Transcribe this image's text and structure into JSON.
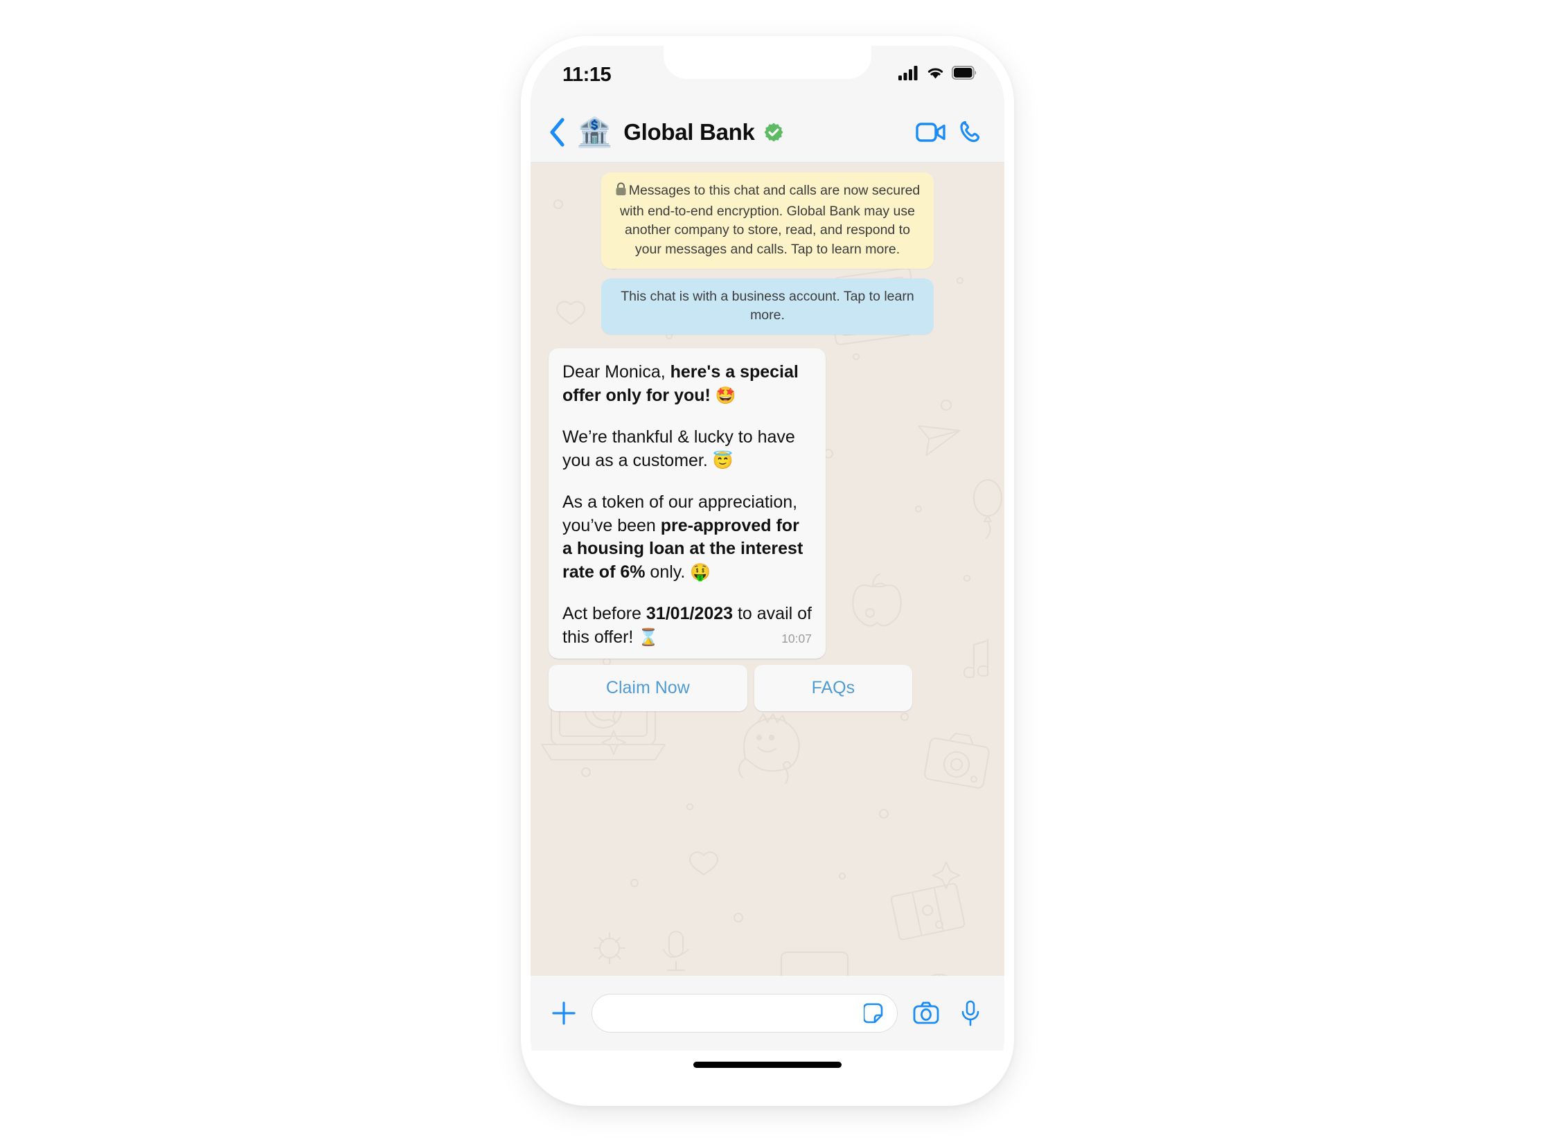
{
  "status_bar": {
    "time": "11:15",
    "signal_icon": "cellular-signal-icon",
    "wifi_icon": "wifi-icon",
    "battery_icon": "battery-icon"
  },
  "chat_header": {
    "back_icon": "back-chevron-icon",
    "avatar_emoji": "🏦",
    "contact_name": "Global Bank",
    "verified_icon": "verified-badge-icon",
    "video_call_icon": "video-call-icon",
    "voice_call_icon": "voice-call-icon"
  },
  "notices": {
    "encryption": {
      "lock_icon": "🔒",
      "text": "Messages to this chat and calls are now secured with end-to-end encryption. Global Bank may use another company to store, read, and respond to your messages and calls. Tap to learn more."
    },
    "business": {
      "text": "This chat is with a business account. Tap to learn more."
    }
  },
  "message": {
    "p1_plain": "Dear Monica, ",
    "p1_bold": "here's a special offer only for you!",
    "p1_emoji": "🤩",
    "p2_plain": "We’re thankful & lucky to have you as a customer.",
    "p2_emoji": "😇",
    "p3_plain_a": "As a token of our appreciation, you’ve been ",
    "p3_bold": "pre-approved for a housing loan at the interest rate of 6%",
    "p3_plain_b": " only.",
    "p3_emoji": "🤑",
    "p4_plain_a": "Act before ",
    "p4_bold": "31/01/2023",
    "p4_plain_b": " to avail of this offer!",
    "p4_emoji": "⌛",
    "timestamp": "10:07"
  },
  "cta_buttons": [
    {
      "label": "Claim Now",
      "name": "claim-now-button"
    },
    {
      "label": "FAQs",
      "name": "faqs-button"
    }
  ],
  "input_bar": {
    "plus_icon": "plus-icon",
    "message_value": "",
    "message_placeholder": "",
    "sticker_icon": "sticker-icon",
    "camera_icon": "camera-icon",
    "mic_icon": "microphone-icon"
  },
  "colors": {
    "accent_blue": "#1b8cf5",
    "link_blue": "#4f9bd4",
    "verified_green": "#5fbb63",
    "encryption_yellow": "#fdf3c9",
    "business_blue": "#c9e6f5",
    "chat_background": "#efe9e2",
    "bubble": "#f8f8f8"
  }
}
